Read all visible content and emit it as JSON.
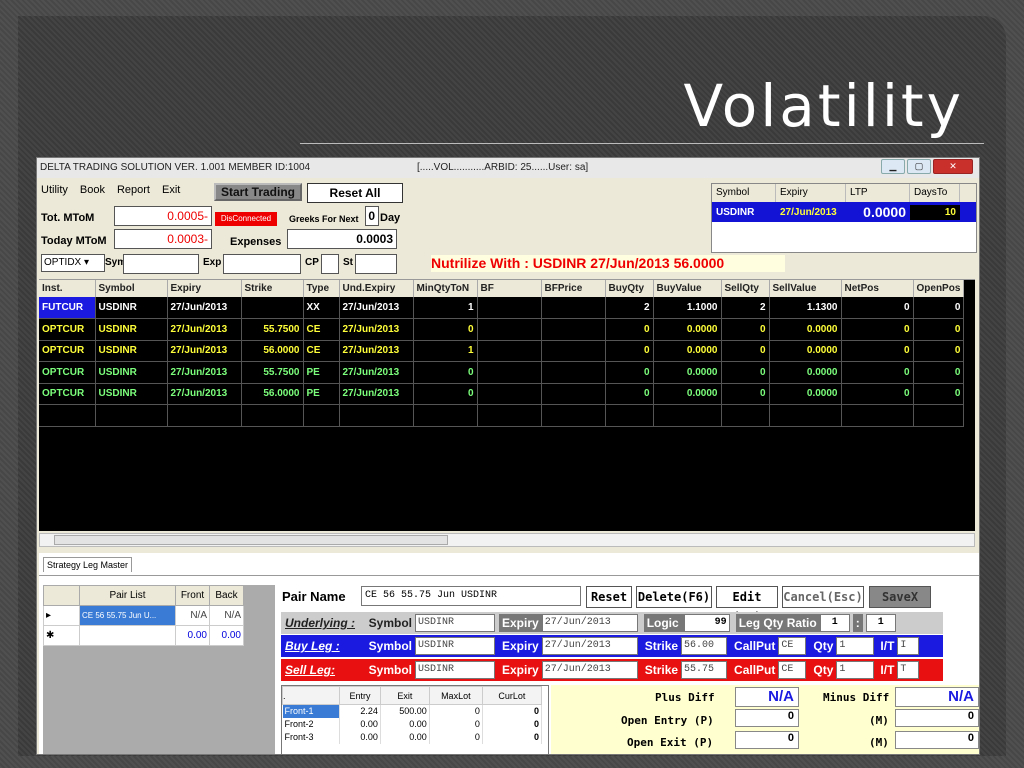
{
  "slide": {
    "title": "Volatility"
  },
  "window": {
    "title": "DELTA TRADING SOLUTION VER. 1.001 MEMBER ID:1004",
    "subtitle": "[.....VOL...........ARBID: 25......User: sa]"
  },
  "menu": [
    "Utility",
    "Book",
    "Report",
    "Exit"
  ],
  "toolbar": {
    "start_trading": "Start Trading",
    "reset_all": "Reset All"
  },
  "stats": {
    "tot_mtom_label": "Tot. MToM",
    "tot_mtom_value": "0.0005-",
    "today_mtom_label": "Today MToM",
    "today_mtom_value": "0.0003-",
    "status": "DisConnected",
    "greeks_label": "Greeks For Next",
    "greeks_days": "0",
    "day_label": "Day",
    "expenses_label": "Expenses",
    "expenses_value": "0.0003"
  },
  "filters": {
    "combo": "OPTIDX",
    "sym": "Sym",
    "exp": "Exp",
    "cp": "CP",
    "st": "St"
  },
  "nutrilize": "Nutrilize With : USDINR     27/Jun/2013 56.0000",
  "ltp": {
    "headers": [
      "Symbol",
      "Expiry",
      "LTP",
      "DaysTo"
    ],
    "row": {
      "symbol": "USDINR",
      "expiry": "27/Jun/2013",
      "ltp": "0.0000",
      "days": "10"
    }
  },
  "grid": {
    "headers": [
      "Inst.",
      "Symbol",
      "Expiry",
      "Strike",
      "Type",
      "Und.Expiry",
      "MinQtyToN",
      "BF",
      "BFPrice",
      "BuyQty",
      "BuyValue",
      "SellQty",
      "SellValue",
      "NetPos",
      "OpenPos"
    ],
    "rows": [
      {
        "inst": "FUTCUR",
        "symbol": "USDINR",
        "expiry": "27/Jun/2013",
        "strike": "",
        "type": "XX",
        "und": "27/Jun/2013",
        "minqty": "1",
        "buyqty": "2",
        "buyval": "1.1000",
        "sellqty": "2",
        "sellval": "1.1300",
        "netpos": "0",
        "openpos": "0",
        "color": "#ffffff"
      },
      {
        "inst": "OPTCUR",
        "symbol": "USDINR",
        "expiry": "27/Jun/2013",
        "strike": "55.7500",
        "type": "CE",
        "und": "27/Jun/2013",
        "minqty": "0",
        "buyqty": "0",
        "buyval": "0.0000",
        "sellqty": "0",
        "sellval": "0.0000",
        "netpos": "0",
        "openpos": "0",
        "color": "#ffff3a"
      },
      {
        "inst": "OPTCUR",
        "symbol": "USDINR",
        "expiry": "27/Jun/2013",
        "strike": "56.0000",
        "type": "CE",
        "und": "27/Jun/2013",
        "minqty": "1",
        "buyqty": "0",
        "buyval": "0.0000",
        "sellqty": "0",
        "sellval": "0.0000",
        "netpos": "0",
        "openpos": "0",
        "color": "#ffff3a"
      },
      {
        "inst": "OPTCUR",
        "symbol": "USDINR",
        "expiry": "27/Jun/2013",
        "strike": "55.7500",
        "type": "PE",
        "und": "27/Jun/2013",
        "minqty": "0",
        "buyqty": "0",
        "buyval": "0.0000",
        "sellqty": "0",
        "sellval": "0.0000",
        "netpos": "0",
        "openpos": "0",
        "color": "#7cff7c"
      },
      {
        "inst": "OPTCUR",
        "symbol": "USDINR",
        "expiry": "27/Jun/2013",
        "strike": "56.0000",
        "type": "PE",
        "und": "27/Jun/2013",
        "minqty": "0",
        "buyqty": "0",
        "buyval": "0.0000",
        "sellqty": "0",
        "sellval": "0.0000",
        "netpos": "0",
        "openpos": "0",
        "color": "#7cff7c"
      }
    ]
  },
  "tab": {
    "label": "Strategy Leg Master"
  },
  "pairs": {
    "headers": [
      "Pair List",
      "Front",
      "Back"
    ],
    "row1": {
      "name": "CE 56 55.75 Jun U...",
      "front": "N/A",
      "back": "N/A"
    },
    "row2": {
      "name": "",
      "front": "0.00",
      "back": "0.00"
    }
  },
  "pair": {
    "label": "Pair Name",
    "value": "CE 56 55.75 Jun USDINR",
    "reset": "Reset",
    "delete": "Delete(F6)",
    "edit": "Edit (F3)",
    "cancel": "Cancel(Esc)",
    "save": "SaveX"
  },
  "underlying": {
    "label": "Underlying :",
    "symbol_label": "Symbol",
    "symbol": "USDINR",
    "expiry_label": "Expiry",
    "expiry": "27/Jun/2013",
    "logic_label": "Logic",
    "logic": "99",
    "ratio_label": "Leg Qty Ratio",
    "ratio1": "1",
    "colon": ":",
    "ratio2": "1"
  },
  "buy_leg": {
    "label": "Buy Leg :",
    "symbol_label": "Symbol",
    "symbol": "USDINR",
    "expiry_label": "Expiry",
    "expiry": "27/Jun/2013",
    "strike_label": "Strike",
    "strike": "56.00",
    "callput_label": "CallPut",
    "callput": "CE",
    "qty_label": "Qty",
    "qty": "1",
    "it_label": "I/T",
    "it": "I"
  },
  "sell_leg": {
    "label": "Sell Leg:",
    "symbol_label": "Symbol",
    "symbol": "USDINR",
    "expiry_label": "Expiry",
    "expiry": "27/Jun/2013",
    "strike_label": "Strike",
    "strike": "55.75",
    "callput_label": "CallPut",
    "callput": "CE",
    "qty_label": "Qty",
    "qty": "1",
    "it_label": "I/T",
    "it": "T"
  },
  "fronts": {
    "headers": [
      ".",
      "Entry",
      "Exit",
      "MaxLot",
      "CurLot"
    ],
    "rows": [
      {
        "name": "Front-1",
        "entry": "2.24",
        "exit": "500.00",
        "maxlot": "0",
        "curlot": "0"
      },
      {
        "name": "Front-2",
        "entry": "0.00",
        "exit": "0.00",
        "maxlot": "0",
        "curlot": "0"
      },
      {
        "name": "Front-3",
        "entry": "0.00",
        "exit": "0.00",
        "maxlot": "0",
        "curlot": "0"
      }
    ]
  },
  "diffs": {
    "plus_label": "Plus Diff",
    "plus": "N/A",
    "minus_label": "Minus Diff",
    "minus": "N/A",
    "open_entry_label": "Open Entry (P)",
    "open_entry": "0",
    "m1_label": "(M)",
    "m1": "0",
    "open_exit_label": "Open Exit  (P)",
    "open_exit": "0",
    "m2_label": "(M)",
    "m2": "0"
  }
}
